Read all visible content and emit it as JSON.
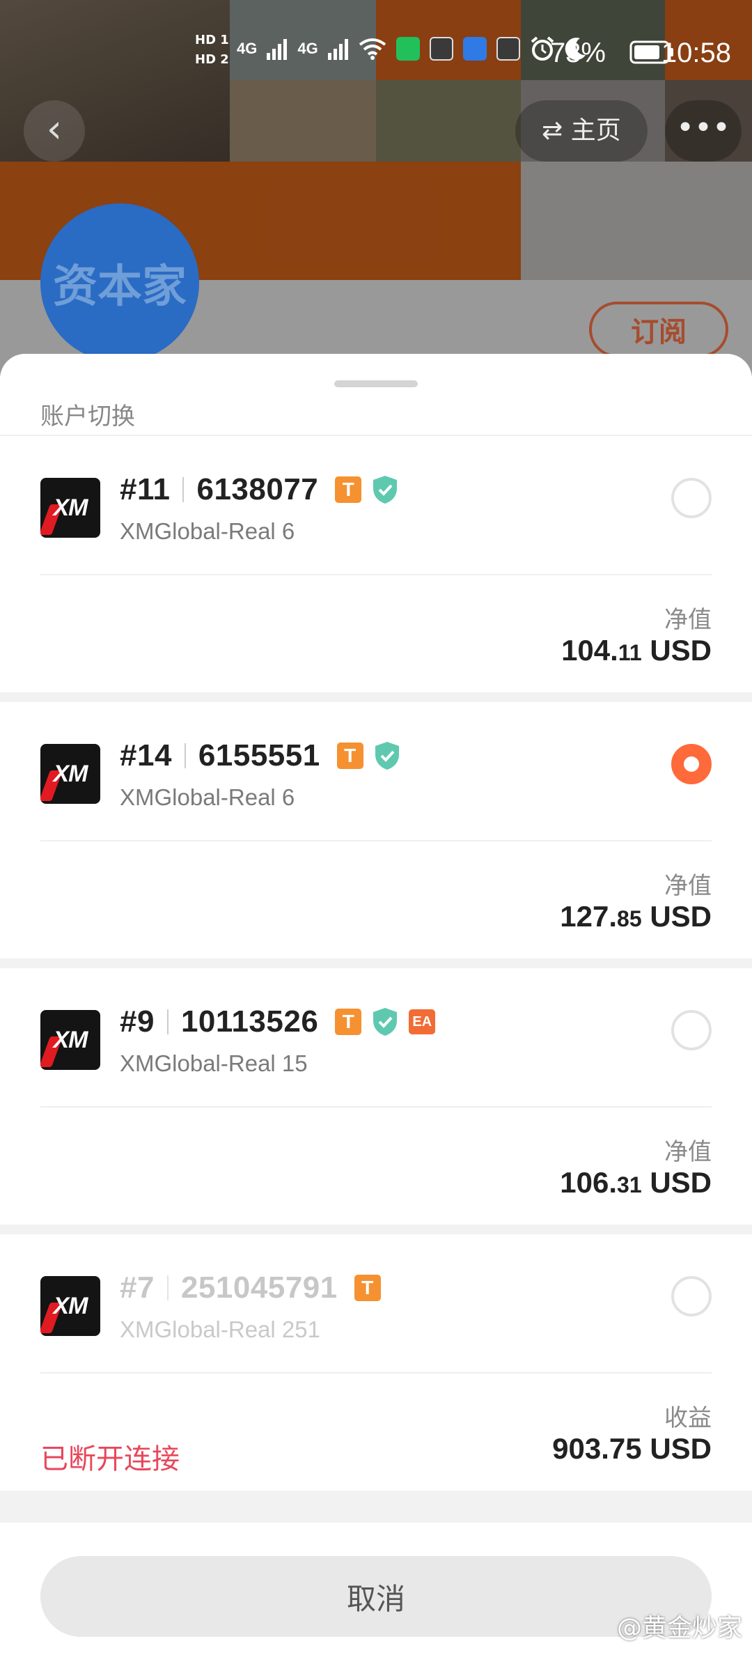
{
  "status_bar": {
    "hd1": "HD 1",
    "hd2": "HD 2",
    "net1": "4G",
    "net2": "4G",
    "battery_pct": "73%",
    "clock": "10:58",
    "icons": [
      "signal-icon",
      "wifi-icon",
      "iqiyi-app-icon",
      "soul-app-icon",
      "windows-app-icon",
      "soul-app-icon",
      "alarm-icon",
      "moon-icon",
      "battery-icon"
    ]
  },
  "header": {
    "back_icon": "chevron-left-icon",
    "home_label": "主页",
    "home_icon": "swap-icon",
    "more_icon": "more-dots-icon",
    "avatar_text": "资本家",
    "subscribe_label": "订阅"
  },
  "sheet": {
    "title": "账户切换",
    "cancel_label": "取消"
  },
  "accounts": [
    {
      "index": "#11",
      "number": "6138077",
      "server": "XMGlobal-Real 6",
      "logo_text": "XM",
      "badges": [
        "T",
        "verified"
      ],
      "selected": false,
      "metric_label": "净值",
      "value_int": "104.",
      "value_dec": "11",
      "currency": "USD",
      "status": ""
    },
    {
      "index": "#14",
      "number": "6155551",
      "server": "XMGlobal-Real 6",
      "logo_text": "XM",
      "badges": [
        "T",
        "verified"
      ],
      "selected": true,
      "metric_label": "净值",
      "value_int": "127.",
      "value_dec": "85",
      "currency": "USD",
      "status": ""
    },
    {
      "index": "#9",
      "number": "10113526",
      "server": "XMGlobal-Real 15",
      "logo_text": "XM",
      "badges": [
        "T",
        "verified",
        "EA"
      ],
      "selected": false,
      "metric_label": "净值",
      "value_int": "106.",
      "value_dec": "31",
      "currency": "USD",
      "status": ""
    },
    {
      "index": "#7",
      "number": "251045791",
      "server": "XMGlobal-Real 251",
      "logo_text": "XM",
      "badges": [
        "T"
      ],
      "selected": false,
      "metric_label": "收益",
      "value_int": "903.75",
      "value_dec": "",
      "currency": "USD",
      "status": "已断开连接"
    }
  ],
  "colors": {
    "accent": "#ff6a3a",
    "badge_t": "#f59130",
    "verified": "#5fc9b0",
    "disconnected": "#e8475b"
  },
  "watermark": "@黄金炒家"
}
